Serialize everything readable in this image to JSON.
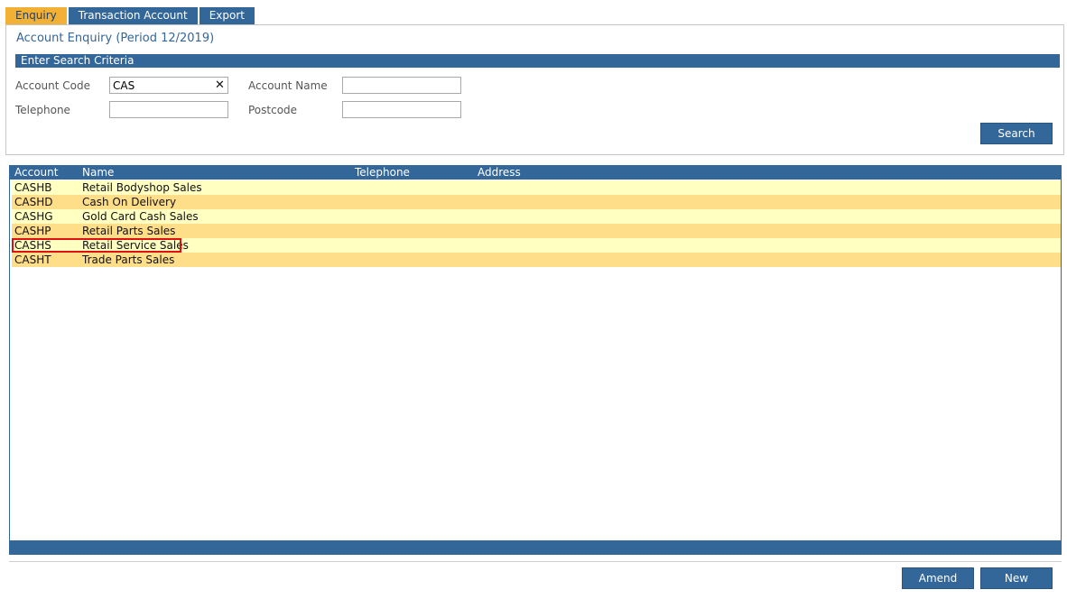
{
  "tabs": [
    {
      "label": "Enquiry",
      "active": true
    },
    {
      "label": "Transaction Account",
      "active": false
    },
    {
      "label": "Export",
      "active": false
    }
  ],
  "panel": {
    "title": "Account Enquiry (Period 12/2019)",
    "criteria_header": "Enter Search Criteria"
  },
  "fields": {
    "account_code": {
      "label": "Account Code",
      "value": "CAS"
    },
    "account_name": {
      "label": "Account Name",
      "value": ""
    },
    "telephone": {
      "label": "Telephone",
      "value": ""
    },
    "postcode": {
      "label": "Postcode",
      "value": ""
    }
  },
  "buttons": {
    "search": "Search",
    "amend": "Amend",
    "new": "New"
  },
  "table": {
    "columns": [
      "Account",
      "Name",
      "Telephone",
      "Address"
    ],
    "rows": [
      {
        "account": "CASHB",
        "name": "Retail Bodyshop Sales",
        "telephone": "",
        "address": ""
      },
      {
        "account": "CASHD",
        "name": "Cash On Delivery",
        "telephone": "",
        "address": ""
      },
      {
        "account": "CASHG",
        "name": "Gold Card Cash Sales",
        "telephone": "",
        "address": ""
      },
      {
        "account": "CASHP",
        "name": "Retail Parts Sales",
        "telephone": "",
        "address": ""
      },
      {
        "account": "CASHS",
        "name": "Retail Service Sales",
        "telephone": "",
        "address": "",
        "highlighted": true
      },
      {
        "account": "CASHT",
        "name": "Trade Parts Sales",
        "telephone": "",
        "address": ""
      }
    ]
  },
  "colors": {
    "primary": "#336699",
    "active_tab": "#f2b035",
    "row_odd": "#ffffc2",
    "row_even": "#ffde8a",
    "highlight": "#e01010"
  }
}
